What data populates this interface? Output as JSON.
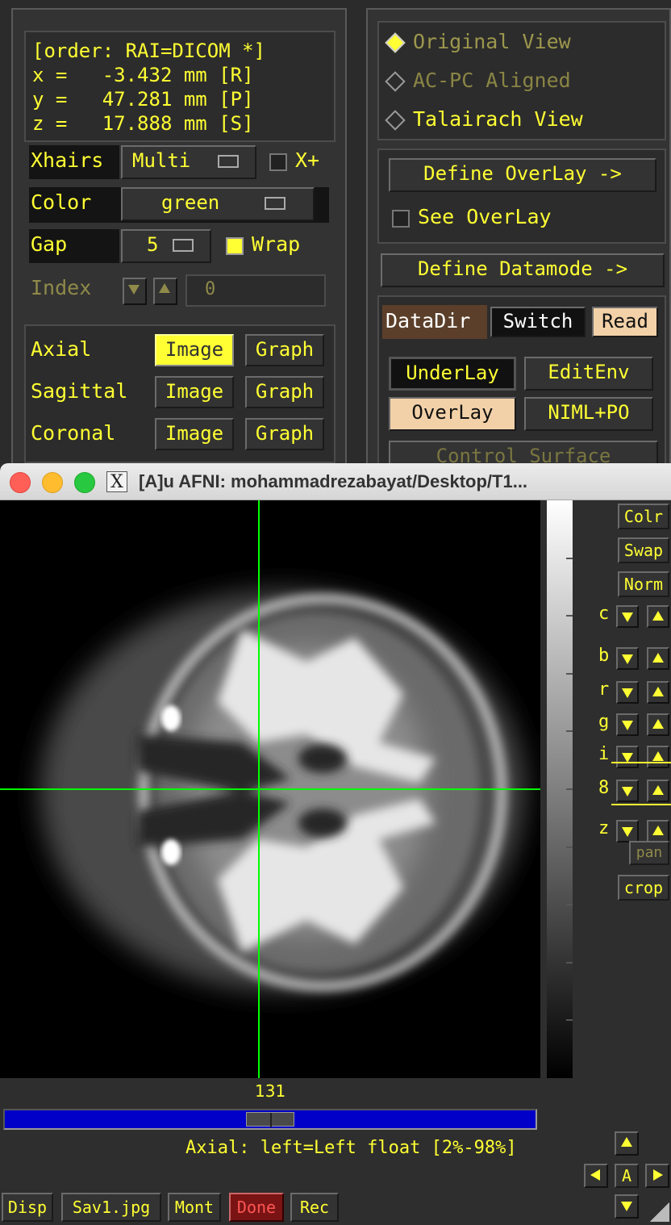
{
  "coords": {
    "order": "[order: RAI=DICOM *]",
    "x": "x =   -3.432 mm [R]",
    "y": "y =   47.281 mm [P]",
    "z": "z =   17.888 mm [S]"
  },
  "xhairs": {
    "label": "Xhairs",
    "value": "Multi",
    "xplus": "X+"
  },
  "color": {
    "label": "Color",
    "value": "green"
  },
  "gap": {
    "label": "Gap",
    "value": "5",
    "wrap": "Wrap"
  },
  "index": {
    "label": "Index",
    "value": "0"
  },
  "views": {
    "axial": "Axial",
    "sagittal": "Sagittal",
    "coronal": "Coronal",
    "image": "Image",
    "graph": "Graph"
  },
  "right_panel": {
    "original_view": "Original View",
    "acpc_view": "AC-PC Aligned",
    "talairach_view": "Talairach View",
    "define_overlay": "Define OverLay ->",
    "see_overlay": "See OverLay",
    "define_datamode": "Define Datamode ->",
    "datadir": "DataDir",
    "switch": "Switch",
    "read": "Read",
    "underlay": "UnderLay",
    "editenv": "EditEnv",
    "overlay": "OverLay",
    "niml": "NIML+PO",
    "control_surface": "Control Surface"
  },
  "window": {
    "title": "[A]u AFNI: mohammadrezabayat/Desktop/T1..."
  },
  "image_window": {
    "slice_number": "131",
    "slider_fraction": 0.5,
    "status": "Axial: left=Left float [2%-98%]",
    "side_buttons": {
      "colr": "Colr",
      "swap": "Swap",
      "norm": "Norm",
      "pan": "pan",
      "crop": "crop"
    },
    "side_letters": [
      "c",
      "b",
      "r",
      "g",
      "i",
      "8",
      "z"
    ],
    "bottom_buttons": {
      "disp": "Disp",
      "save": "Sav1.jpg",
      "mont": "Mont",
      "done": "Done",
      "rec": "Rec"
    },
    "center_label": "A"
  },
  "colors": {
    "accent": "#ffff33",
    "crosshair": "#00ff00",
    "done": "#ff4444",
    "slider": "#0000c8"
  }
}
